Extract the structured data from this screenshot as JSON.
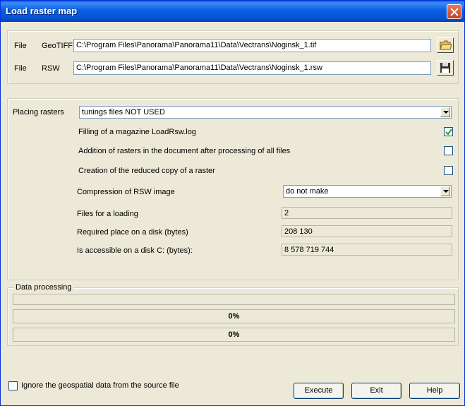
{
  "window": {
    "title": "Load raster map"
  },
  "files": {
    "geotiff": {
      "label1": "File",
      "label2": "GeoTIFF",
      "path": "C:\\Program Files\\Panorama\\Panorama11\\Data\\Vectrans\\Noginsk_1.tif"
    },
    "rsw": {
      "label1": "File",
      "label2": "RSW",
      "path": "C:\\Program Files\\Panorama\\Panorama11\\Data\\Vectrans\\Noginsk_1.rsw"
    }
  },
  "settings": {
    "placing_label": "Placing rasters",
    "placing_value": "tunings files NOT USED",
    "opt_log": {
      "label": "Filling of a magazine LoadRsw.log",
      "checked": true
    },
    "opt_add": {
      "label": "Addition of rasters in the document after processing of all files",
      "checked": false
    },
    "opt_reduced": {
      "label": "Creation of the reduced copy of a raster",
      "checked": false
    },
    "compression_label": "Compression of RSW image",
    "compression_value": "do not make",
    "files_count_label": "Files for a loading",
    "files_count": "2",
    "required_label": "Required place on a disk (bytes)",
    "required_value": "208 130",
    "accessible_label": "Is accessible on a disk C: (bytes):",
    "accessible_value": "8 578 719 744"
  },
  "processing": {
    "caption": "Data processing",
    "progress1": "0%",
    "progress2": "0%"
  },
  "footer": {
    "ignore_label": "Ignore the geospatial data from the source file",
    "ignore_checked": false,
    "execute": "Execute",
    "exit": "Exit",
    "help": "Help"
  }
}
